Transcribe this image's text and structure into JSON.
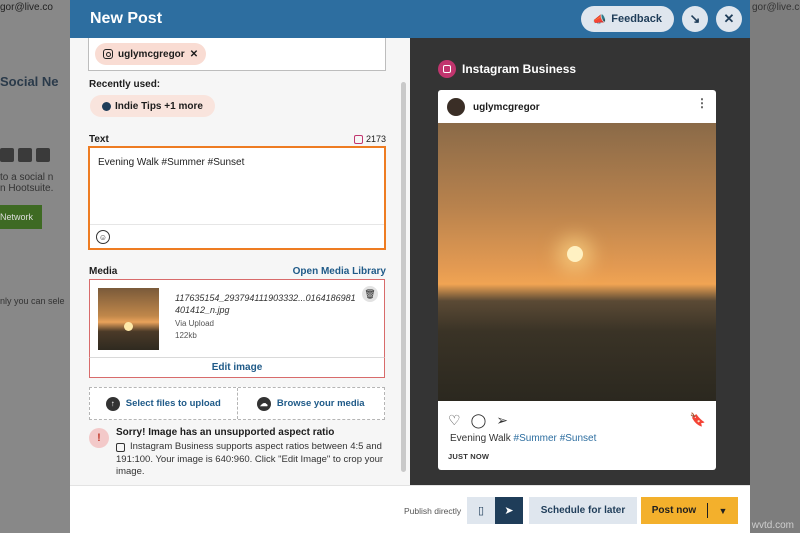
{
  "background": {
    "email": "gor@live.co",
    "email_right": "gor@live.co.",
    "social_heading": "Social Ne",
    "connect_text": "to a social n",
    "connect_text2": "n Hootsuite.",
    "network_button": "Network",
    "select_text": "nly you can sele"
  },
  "header": {
    "title": "New Post",
    "feedback_label": "Feedback",
    "minimize_icon": "↘",
    "close_icon": "✕"
  },
  "compose": {
    "selected_account": "uglymcgregor",
    "recently_used_label": "Recently used:",
    "recent_chip": "Indie Tips +1 more",
    "text_label": "Text",
    "char_count": "2173",
    "text_value": "Evening Walk #Summer #Sunset",
    "emoji_icon": "☺",
    "media_label": "Media",
    "open_media_library": "Open Media Library",
    "media_filename": "117635154_293794111903332...0164186981 401412_n.jpg",
    "media_source": "Via Upload",
    "media_size": "122kb",
    "edit_image": "Edit image",
    "select_files": "Select files to upload",
    "browse_media": "Browse your media",
    "warning_title": "Sorry! Image has an unsupported aspect ratio",
    "warning_body": "Instagram Business supports aspect ratios between 4:5 and 191:100. Your image is 640:960. Click \"Edit Image\" to crop your image."
  },
  "preview": {
    "network": "Instagram Business",
    "username": "uglymcgregor",
    "caption_text": "Evening Walk ",
    "hashtag1": "#Summer",
    "hashtag2": "#Sunset",
    "timestamp": "JUST NOW"
  },
  "footer": {
    "publish_label": "Publish directly",
    "schedule_label": "Schedule for later",
    "post_now_label": "Post now"
  },
  "watermark": "wvtd.com",
  "colors": {
    "header": "#2d6ea0",
    "accent_orange": "#ee7c22",
    "post_now": "#f3b02c",
    "navy": "#1f3d59"
  }
}
